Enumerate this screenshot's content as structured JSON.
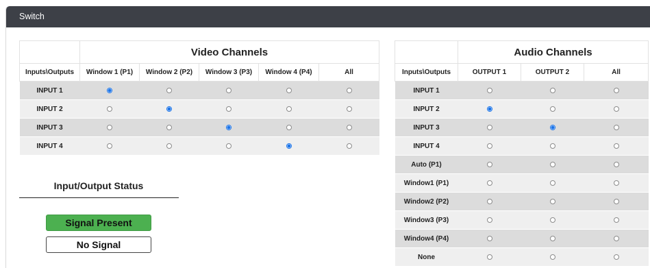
{
  "panel": {
    "title": "Switch"
  },
  "video": {
    "title": "Video Channels",
    "corner_label": "Inputs\\Outputs",
    "columns": [
      "Window 1 (P1)",
      "Window 2 (P2)",
      "Window 3 (P3)",
      "Window 4 (P4)",
      "All"
    ],
    "rows": [
      {
        "label": "INPUT 1",
        "selected": 0
      },
      {
        "label": "INPUT 2",
        "selected": 1
      },
      {
        "label": "INPUT 3",
        "selected": 2
      },
      {
        "label": "INPUT 4",
        "selected": 3
      }
    ]
  },
  "audio": {
    "title": "Audio Channels",
    "corner_label": "Inputs\\Outputs",
    "columns": [
      "OUTPUT 1",
      "OUTPUT 2",
      "All"
    ],
    "rows": [
      {
        "label": "INPUT 1",
        "selected": -1
      },
      {
        "label": "INPUT 2",
        "selected": 0
      },
      {
        "label": "INPUT 3",
        "selected": 1
      },
      {
        "label": "INPUT 4",
        "selected": -1
      },
      {
        "label": "Auto (P1)",
        "selected": -1
      },
      {
        "label": "Window1 (P1)",
        "selected": -1
      },
      {
        "label": "Window2 (P2)",
        "selected": -1
      },
      {
        "label": "Window3 (P3)",
        "selected": -1
      },
      {
        "label": "Window4 (P4)",
        "selected": -1
      },
      {
        "label": "None",
        "selected": -1
      }
    ]
  },
  "status": {
    "title": "Input/Output Status",
    "signal_present": "Signal Present",
    "no_signal": "No Signal",
    "colors": {
      "present": "#4cb050",
      "radio_selected": "#1a73e8"
    }
  }
}
